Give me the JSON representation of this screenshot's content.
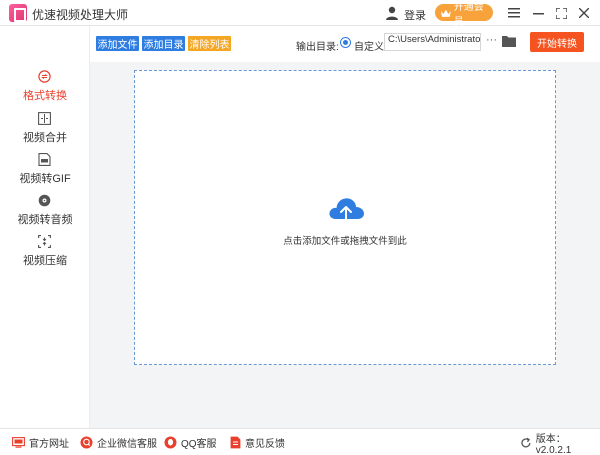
{
  "app": {
    "title": "优速视频处理大师"
  },
  "header": {
    "login_label": "登录",
    "vip_label": "开通会员"
  },
  "toolbar": {
    "add_file_label": "添加文件",
    "add_dir_label": "添加目录",
    "clear_list_label": "清除列表",
    "output_dir_label": "输出目录:",
    "custom_label": "自定义",
    "output_path": "C:\\Users\\Administrator",
    "more_label": "···",
    "start_label": "开始转换"
  },
  "sidebar": {
    "items": [
      {
        "label": "格式转换",
        "active": true
      },
      {
        "label": "视频合并"
      },
      {
        "label": "视频转GIF"
      },
      {
        "label": "视频转音频"
      },
      {
        "label": "视频压缩"
      }
    ]
  },
  "main": {
    "drop_hint": "点击添加文件或拖拽文件到此"
  },
  "footer": {
    "website_label": "官方网址",
    "wechat_label": "企业微信客服",
    "qq_label": "QQ客服",
    "feedback_label": "意见反馈",
    "version_label": "版本：v2.0.2.1"
  },
  "colors": {
    "accent_blue": "#2f7de1",
    "accent_orange": "#f5531f",
    "clear_orange": "#f5a623",
    "active_red": "#e8402c"
  }
}
